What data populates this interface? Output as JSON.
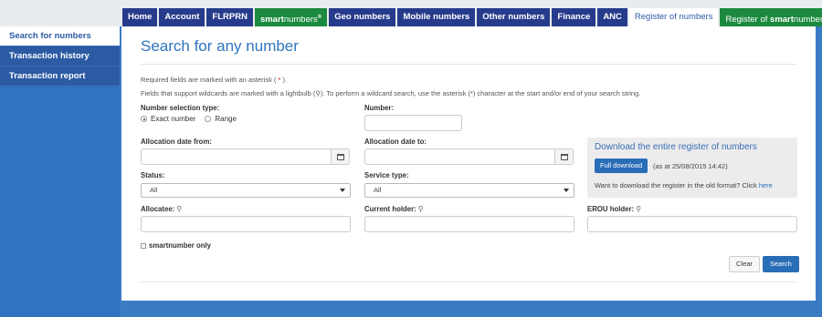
{
  "tabs": [
    {
      "label": "Home"
    },
    {
      "label": "Account"
    },
    {
      "label": "FLRPRN"
    },
    {
      "label_a": "smart",
      "label_b": "numbers",
      "reg": "®"
    },
    {
      "label": "Geo numbers"
    },
    {
      "label": "Mobile numbers"
    },
    {
      "label": "Other numbers"
    },
    {
      "label": "Finance"
    },
    {
      "label": "ANC"
    },
    {
      "label": "Register of numbers"
    },
    {
      "label_pre": "Register of ",
      "label_a": "smart",
      "label_b": "numbers",
      "reg": "®"
    }
  ],
  "sidebar": {
    "items": [
      {
        "label": "Search for numbers"
      },
      {
        "label": "Transaction history"
      },
      {
        "label": "Transaction report"
      }
    ]
  },
  "main": {
    "title": "Search for any number",
    "required_note_pre": "Required fields are marked with an asterisk (",
    "required_note_ast": " * ",
    "required_note_post": ").",
    "wildcard_note_pre": "Fields that support wildcards are marked with a lightbulb (",
    "wildcard_note_post": "). To perform a wildcard search, use the asterisk (*) character at the start and/or end of your search string.",
    "number_selection_type_label": "Number selection type:",
    "radio_exact": "Exact number",
    "radio_range": "Range",
    "number_label": "Number:",
    "number_value": "",
    "alloc_from_label": "Allocation date from:",
    "alloc_to_label": "Allocation date to:",
    "status_label": "Status:",
    "status_value": "All",
    "service_type_label": "Service type:",
    "service_type_value": "All",
    "allocatee_label": "Allocatee:",
    "current_holder_label": "Current holder:",
    "erou_holder_label": "EROU holder:",
    "smartnumber_only_label": "smartnumber only",
    "clear_label": "Clear",
    "search_label": "Search"
  },
  "download": {
    "title": "Download the entire register of numbers",
    "full_download_label": "Full download",
    "as_at": "(as at 25/08/2015 14:42)",
    "old_format_text": "Want to download the register in the old format? Click ",
    "old_format_link": "here"
  },
  "icons": {
    "lightbulb": "lightbulb-icon",
    "calendar": "calendar-icon",
    "caret": "caret-down-icon"
  },
  "colors": {
    "nav_blue": "#273b8c",
    "nav_green": "#1b8a3e",
    "accent": "#2e75bf",
    "background": "#3a7cc4"
  }
}
